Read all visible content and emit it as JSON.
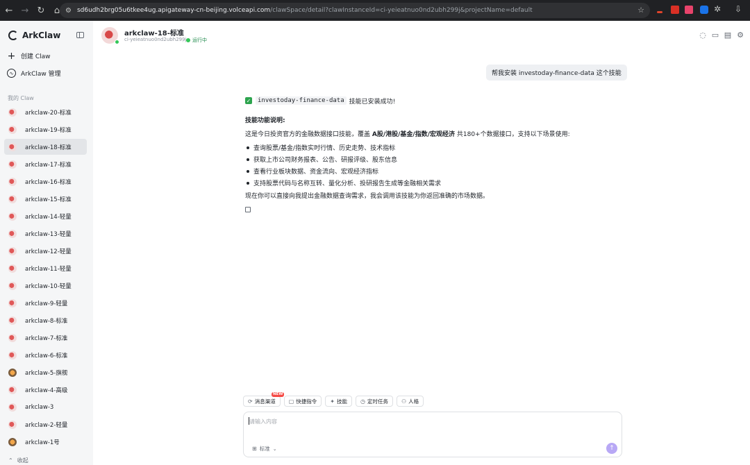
{
  "browser": {
    "url_host": "sd6udh2brg05u6tkee4ug.apigateway-cn-beijing.volceapi.com",
    "url_path": "/clawSpace/detail?clawInstanceId=ci-yeieatnuo0nd2ubh299j&projectName=default"
  },
  "sidebar": {
    "brand": "ArkClaw",
    "create_label": "创建 Claw",
    "manage_label": "ArkClaw 管理",
    "section_label": "我的 Claw",
    "items": [
      {
        "label": "arkclaw-20-标准",
        "avatar": "claw"
      },
      {
        "label": "arkclaw-19-标准",
        "avatar": "claw"
      },
      {
        "label": "arkclaw-18-标准",
        "avatar": "claw",
        "active": true
      },
      {
        "label": "arkclaw-17-标准",
        "avatar": "claw"
      },
      {
        "label": "arkclaw-16-标准",
        "avatar": "claw"
      },
      {
        "label": "arkclaw-15-标准",
        "avatar": "claw"
      },
      {
        "label": "arkclaw-14-轻量",
        "avatar": "claw"
      },
      {
        "label": "arkclaw-13-轻量",
        "avatar": "claw"
      },
      {
        "label": "arkclaw-12-轻量",
        "avatar": "claw"
      },
      {
        "label": "arkclaw-11-轻量",
        "avatar": "claw"
      },
      {
        "label": "arkclaw-10-轻量",
        "avatar": "claw"
      },
      {
        "label": "arkclaw-9-轻量",
        "avatar": "claw"
      },
      {
        "label": "arkclaw-8-标准",
        "avatar": "claw"
      },
      {
        "label": "arkclaw-7-标准",
        "avatar": "claw"
      },
      {
        "label": "arkclaw-6-标准",
        "avatar": "claw"
      },
      {
        "label": "arkclaw-5-旗舰",
        "avatar": "orange"
      },
      {
        "label": "arkclaw-4-高级",
        "avatar": "claw"
      },
      {
        "label": "arkclaw-3",
        "avatar": "claw"
      },
      {
        "label": "arkclaw-2-轻量",
        "avatar": "claw"
      },
      {
        "label": "arkclaw-1号",
        "avatar": "orange"
      }
    ],
    "fold_label": "收起"
  },
  "header": {
    "title": "arkclaw-18-标准",
    "instance_id": "ci-yeieatnuo0nd2ubh299j",
    "status": "运行中"
  },
  "chat": {
    "user_message": "帮我安装 investoday-finance-data 这个技能",
    "reply": {
      "skill_name": "investoday-finance-data",
      "success_text": "技能已安装成功!",
      "section_title": "技能功能说明:",
      "desc_prefix": "这是今日投资官方的金融数据接口技能，覆盖 ",
      "desc_bold": "A股/港股/基金/指数/宏观经济",
      "desc_suffix": " 共180+个数据接口，支持以下场景使用:",
      "bullets": [
        "查询股票/基金/指数实时行情、历史走势、技术指标",
        "获取上市公司财务报表、公告、研报评级、股东信息",
        "查看行业板块数据、资金流向、宏观经济指标",
        "支持股票代码与名称互转、量化分析、投研报告生成等金融相关需求"
      ],
      "outro": "现在你可以直接向我提出金融数据查询需求，我会调用该技能为你返回准确的市场数据。"
    }
  },
  "composer": {
    "chips": [
      {
        "label": "消息渠道",
        "icon": "channel-icon",
        "badge": "NEW"
      },
      {
        "label": "快捷指令",
        "icon": "shortcut-icon"
      },
      {
        "label": "技能",
        "icon": "skill-icon"
      },
      {
        "label": "定时任务",
        "icon": "clock-icon"
      },
      {
        "label": "人格",
        "icon": "persona-icon"
      }
    ],
    "placeholder": "请输入内容",
    "model_label": "标准"
  }
}
